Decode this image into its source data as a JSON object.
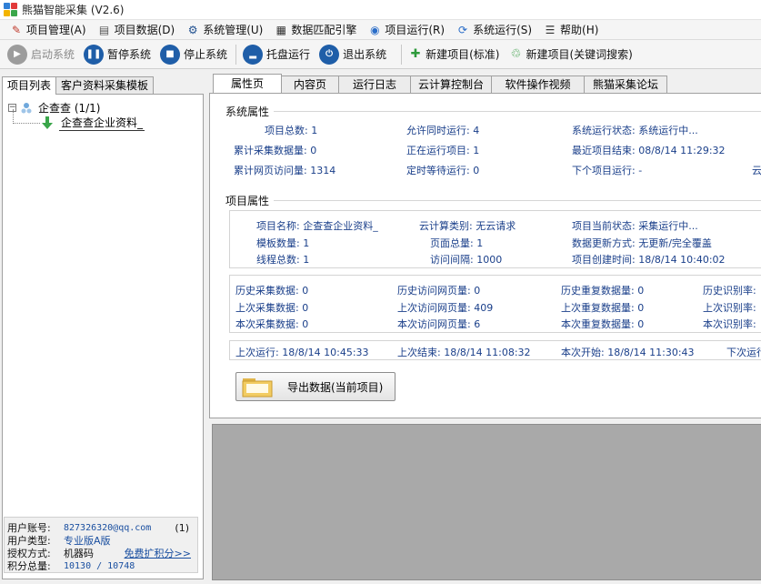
{
  "window": {
    "title": "熊猫智能采集  (V2.6)"
  },
  "menu": [
    {
      "label": "项目管理(A)",
      "icon": "project-manage-icon",
      "name": "menu-project-manage"
    },
    {
      "label": "项目数据(D)",
      "icon": "project-data-icon",
      "name": "menu-project-data"
    },
    {
      "label": "系统管理(U)",
      "icon": "system-manage-icon",
      "name": "menu-system-manage"
    },
    {
      "label": "数据匹配引擎",
      "icon": "data-match-icon",
      "name": "menu-data-match"
    },
    {
      "label": "项目运行(R)",
      "icon": "project-run-icon",
      "name": "menu-project-run"
    },
    {
      "label": "系统运行(S)",
      "icon": "system-run-icon",
      "name": "menu-system-run"
    },
    {
      "label": "帮助(H)",
      "icon": "help-icon",
      "name": "menu-help"
    }
  ],
  "toolbar": {
    "start": "启动系统",
    "pause": "暂停系统",
    "stop": "停止系统",
    "tray": "托盘运行",
    "exit": "退出系统",
    "new_standard": "新建项目(标准)",
    "new_keyword": "新建项目(关键词搜索)"
  },
  "left_tabs": [
    "项目列表",
    "客户资料采集模板"
  ],
  "tree": {
    "root": "企查查 (1/1)",
    "child": "企查查企业资料_"
  },
  "account": {
    "user_label": "用户账号:",
    "user_value": "827326320@qq.com",
    "user_count": "(1)",
    "type_label": "用户类型:",
    "type_value": "专业版A版",
    "auth_label": "授权方式:",
    "auth_value": "机器码",
    "auth_link": "免费扩积分>>",
    "points_label": "积分总量:",
    "points_value": "10130 / 10748"
  },
  "right_tabs": [
    "属性页",
    "内容页",
    "运行日志",
    "云计算控制台",
    "软件操作视频",
    "熊猫采集论坛"
  ],
  "system_props": {
    "title": "系统属性",
    "project_total_k": "项目总数:",
    "project_total_v": "1",
    "allow_k": "允许同时运行:",
    "allow_v": "4",
    "status_k": "系统运行状态:",
    "status_v": "系统运行中...",
    "acc_data_k": "累计采集数据量:",
    "acc_data_v": "0",
    "running_k": "正在运行项目:",
    "running_v": "1",
    "last_end_k": "最近项目结束:",
    "last_end_v": "08/8/14 11:29:32",
    "acc_visit_k": "累计网页访问量:",
    "acc_visit_v": "1314",
    "timed_k": "定时等待运行:",
    "timed_v": "0",
    "next_k": "下个项目运行:",
    "next_v": "-",
    "cut_text": "云"
  },
  "project_props": {
    "title": "项目属性",
    "name_k": "项目名称:",
    "name_v": "企查查企业资料_",
    "cloud_k": "云计算类别:",
    "cloud_v": "无云请求",
    "cur_status_k": "项目当前状态:",
    "cur_status_v": "采集运行中...",
    "tpl_k": "模板数量:",
    "tpl_v": "1",
    "pages_k": "页面总量:",
    "pages_v": "1",
    "update_k": "数据更新方式:",
    "update_v": "无更新/完全覆盖",
    "threads_k": "线程总数:",
    "threads_v": "1",
    "interval_k": "访问间隔:",
    "interval_v": "1000",
    "created_k": "项目创建时间:",
    "created_v": "18/8/14 10:40:02"
  },
  "stats": {
    "hist_data_k": "历史采集数据:",
    "hist_data_v": "0",
    "hist_visit_k": "历史访问网页量:",
    "hist_visit_v": "0",
    "hist_dup_k": "历史重复数据量:",
    "hist_dup_v": "0",
    "hist_rate_k": "历史识别率:",
    "last_data_k": "上次采集数据:",
    "last_data_v": "0",
    "last_visit_k": "上次访问网页量:",
    "last_visit_v": "409",
    "last_dup_k": "上次重复数据量:",
    "last_dup_v": "0",
    "last_rate_k": "上次识别率:",
    "cur_data_k": "本次采集数据:",
    "cur_data_v": "0",
    "cur_visit_k": "本次访问网页量:",
    "cur_visit_v": "6",
    "cur_dup_k": "本次重复数据量:",
    "cur_dup_v": "0",
    "cur_rate_k": "本次识别率:"
  },
  "times": {
    "last_run_k": "上次运行:",
    "last_run_v": "18/8/14 10:45:33",
    "last_end_k": "上次结束:",
    "last_end_v": "18/8/14 11:08:32",
    "this_start_k": "本次开始:",
    "this_start_v": "18/8/14 11:30:43",
    "next_run_k": "下次运行:"
  },
  "export_button": "导出数据(当前项目)",
  "colors": {
    "accent_blue": "#1a3f8a",
    "toolbar_blue": "#1f5ea8",
    "gray_area": "#a9a9a9"
  }
}
